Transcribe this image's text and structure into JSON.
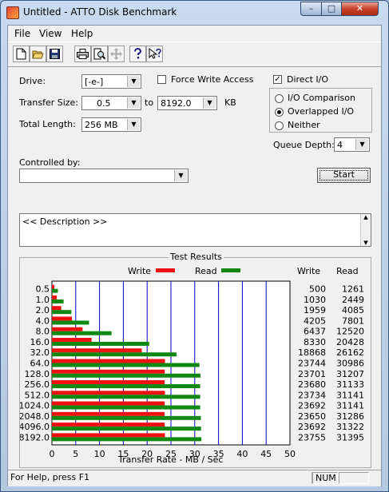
{
  "window": {
    "title": "Untitled - ATTO Disk Benchmark",
    "min": "–",
    "max": "□",
    "close": "✕"
  },
  "menu": [
    "File",
    "View",
    "Help"
  ],
  "toolbar": [
    "new-icon",
    "open-icon",
    "save-icon",
    "print-icon",
    "print-preview-icon",
    "move-icon",
    "help-icon",
    "context-help-icon"
  ],
  "form": {
    "drive_label": "Drive:",
    "drive_value": "[-e-]",
    "force_write_label": "Force Write Access",
    "force_write_checked": false,
    "direct_io_label": "Direct I/O",
    "direct_io_checked": true,
    "transfer_size_label": "Transfer Size:",
    "transfer_from": "0.5",
    "to_label": "to",
    "transfer_to": "8192.0",
    "kb_label": "KB",
    "total_length_label": "Total Length:",
    "total_length_value": "256 MB",
    "radio_io_comparison": "I/O Comparison",
    "radio_overlapped": "Overlapped I/O",
    "radio_neither": "Neither",
    "selected_radio": "overlapped",
    "queue_depth_label": "Queue Depth:",
    "queue_depth_value": "4",
    "controlled_by_label": "Controlled by:",
    "controlled_by_value": "",
    "start_label": "Start",
    "description": "<< Description >>"
  },
  "results": {
    "title": "Test Results",
    "legend_write": "Write",
    "legend_read": "Read",
    "col_write": "Write",
    "col_read": "Read",
    "xlabel": "Transfer Rate - MB / Sec"
  },
  "colors": {
    "write": "#ee1111",
    "read": "#118811",
    "grid": "#0000cc"
  },
  "chart_data": {
    "type": "bar",
    "orientation": "horizontal",
    "title": "Test Results",
    "xlabel": "Transfer Rate - MB / Sec",
    "xlim": [
      0,
      50
    ],
    "xticks": [
      0,
      5,
      10,
      15,
      20,
      25,
      30,
      35,
      40,
      45,
      50
    ],
    "grid": true,
    "legend": "top",
    "categories": [
      "0.5",
      "1.0",
      "2.0",
      "4.0",
      "8.0",
      "16.0",
      "32.0",
      "64.0",
      "128.0",
      "256.0",
      "512.0",
      "1024.0",
      "2048.0",
      "4096.0",
      "8192.0"
    ],
    "series": [
      {
        "name": "Write",
        "values": [
          500,
          1030,
          1959,
          4205,
          6437,
          8330,
          18868,
          23744,
          23701,
          23680,
          23734,
          23692,
          23650,
          23692,
          23755
        ]
      },
      {
        "name": "Read",
        "values": [
          1261,
          2449,
          4085,
          7801,
          12520,
          20428,
          26162,
          30986,
          31207,
          31133,
          31141,
          31141,
          31286,
          31322,
          31395
        ]
      }
    ]
  },
  "status": {
    "help": "For Help, press F1",
    "num": "NUM"
  }
}
